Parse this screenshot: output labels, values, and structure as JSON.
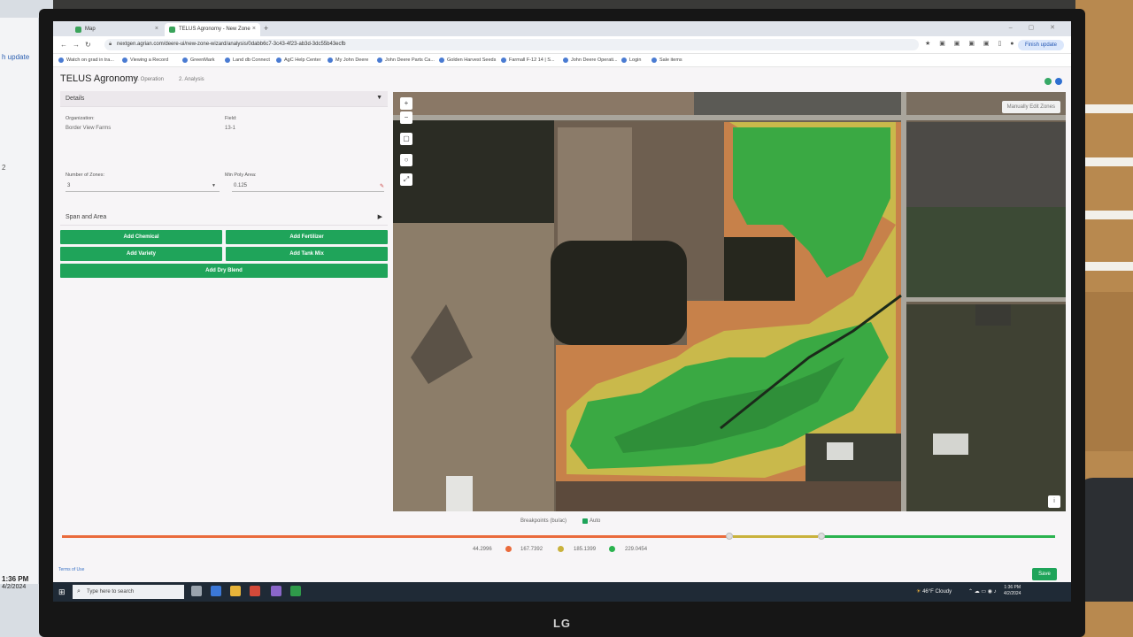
{
  "colors": {
    "accent": "#1fa45a",
    "zone_low": "#ea6b3c",
    "zone_mid": "#c9b23c",
    "zone_high": "#2bb34f"
  },
  "browser": {
    "tabs": [
      {
        "label": "Map"
      },
      {
        "label": "TELUS Agronomy - New Zone"
      }
    ],
    "new_tab": "+",
    "url": "nextgen.agrian.com/deere-ui/new-zone-wizard/analysis/0dabb6c7-3c43-4f23-ab3d-3dc55b43ecfb",
    "update_label": "Finish update",
    "bookmarks": [
      "Watch on grad in tra...",
      "Viewing a Record",
      "GreenMark",
      "Land db Connect",
      "AgC Help Center",
      "My John Deere",
      "John Deere Parts Ca...",
      "Golden Harvest Seeds",
      "Farmall F-12 14 | S...",
      "John Deere Operati...",
      "Login",
      "Sale items"
    ]
  },
  "app": {
    "brand": "TELUS Agronomy",
    "steps": [
      "1. Operation",
      "2. Analysis"
    ]
  },
  "details": {
    "section_label": "Details",
    "organization_label": "Organization:",
    "organization_value": "Border View Farms",
    "field_label": "Field:",
    "field_value": "13-1",
    "zones_label": "Number of Zones:",
    "zones_value": "3",
    "min_poly_label": "Min Poly Area:",
    "min_poly_value": "0.125"
  },
  "span": {
    "section_label": "Span and Area"
  },
  "actions": {
    "add_chemical": "Add Chemical",
    "add_fertilizer": "Add Fertilizer",
    "add_variety": "Add Variety",
    "add_tank_mix": "Add Tank Mix",
    "add_dry_blend": "Add Dry Blend"
  },
  "map": {
    "manual_edit": "Manually Edit Zones",
    "zoom_in": "+",
    "zoom_out": "−",
    "info": "i"
  },
  "breakpoints": {
    "title": "Breakpoints (bu/ac)",
    "auto_label": "Auto",
    "values": [
      "44.2996",
      "167.7392",
      "185.1399",
      "229.0454"
    ]
  },
  "footer": {
    "terms": "Terms of Use",
    "save": "Save"
  },
  "taskbar": {
    "search_placeholder": "Type here to search",
    "weather": "46°F Cloudy",
    "time": "1:36 PM",
    "date": "4/2/2024"
  },
  "room": {
    "left_label_1": "h update",
    "left_label_2": "2",
    "left_time": "1:36 PM",
    "left_date": "4/2/2024",
    "monitor_logo": "LG"
  }
}
